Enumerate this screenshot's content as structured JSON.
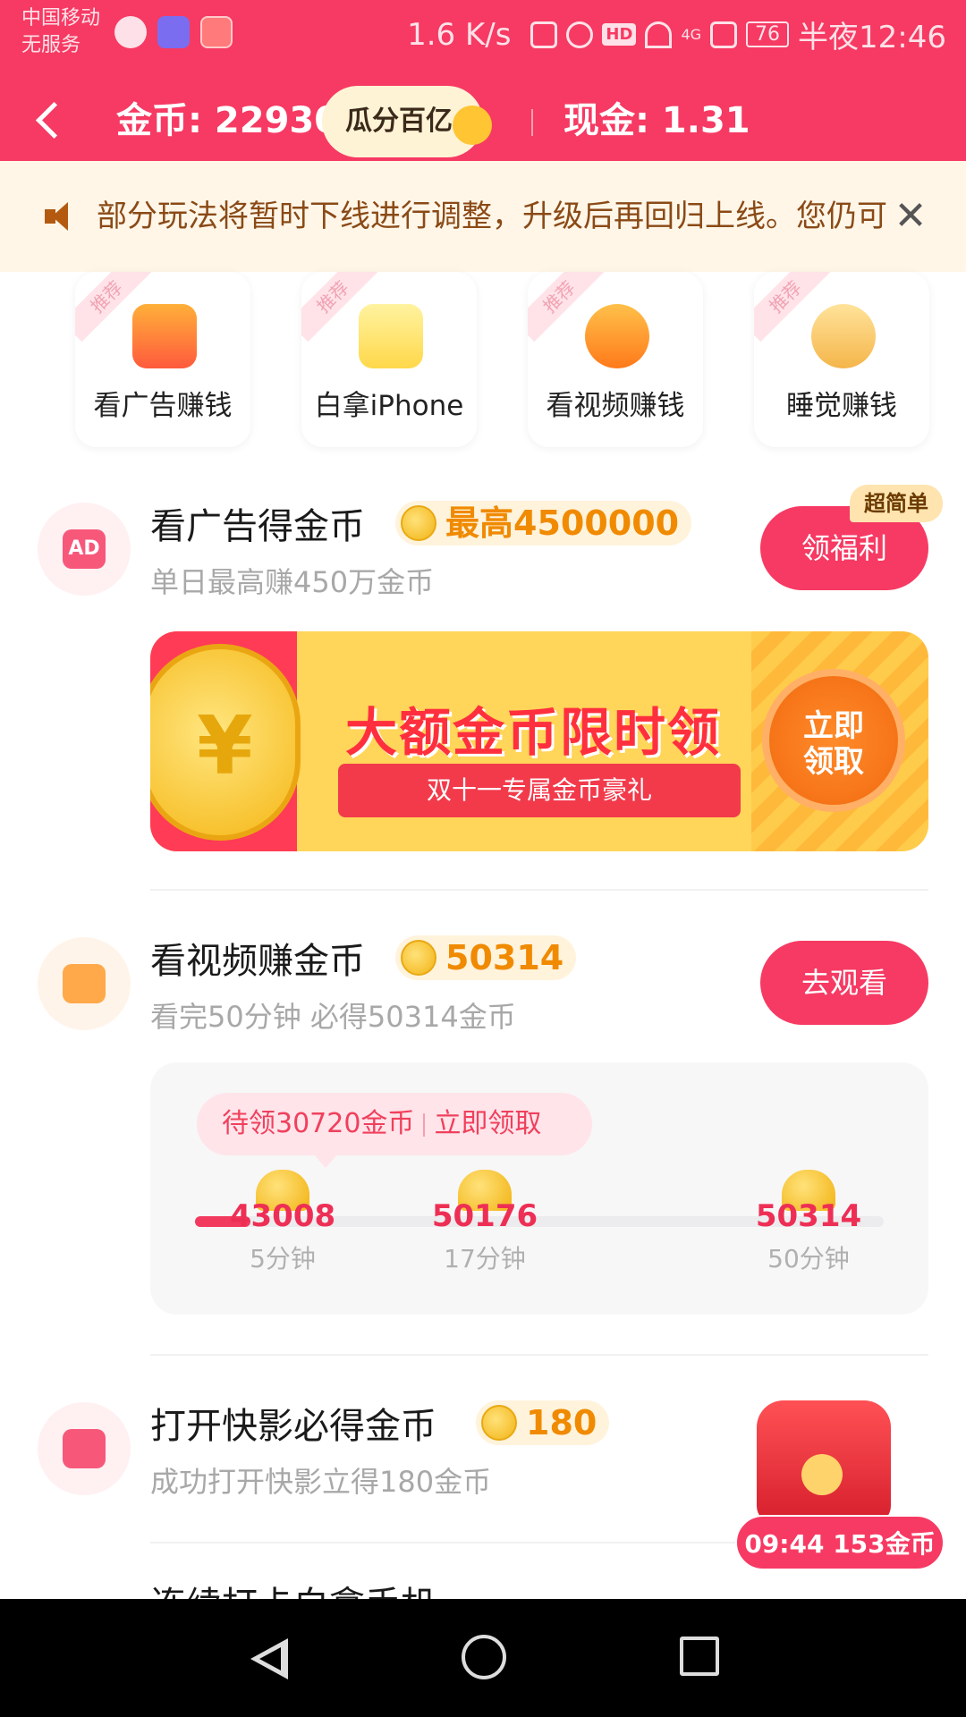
{
  "status_bar": {
    "carrier_line1": "中国移动",
    "carrier_line2": "无服务",
    "speed": "1.6 K/s",
    "hd": "HD",
    "network": "4G",
    "battery": "76",
    "time": "半夜12:46"
  },
  "header": {
    "coins": "金币: 22930",
    "split_pill": "瓜分百亿",
    "cash": "现金: 1.31",
    "bg_color": "#f63a63"
  },
  "notice": {
    "text": "部分玩法将暂时下线进行调整，升级后再回归上线。您仍可",
    "close": "✕"
  },
  "tiles": [
    {
      "tag": "推荐",
      "label": "看广告赚钱",
      "icon": "tv-ad-icon"
    },
    {
      "tag": "推荐",
      "label": "白拿iPhone",
      "icon": "iphone-icon"
    },
    {
      "tag": "推荐",
      "label": "看视频赚钱",
      "icon": "video-camera-icon"
    },
    {
      "tag": "推荐",
      "label": "睡觉赚钱",
      "icon": "sleeping-person-icon"
    }
  ],
  "tasks": {
    "ad": {
      "title": "看广告得金币",
      "reward": "最高4500000",
      "subtitle": "单日最高赚450万金币",
      "button": "领福利",
      "badge": "超简单",
      "icon_text": "AD"
    },
    "banner": {
      "coin_symbol": "¥",
      "headline": "大额金币限时领",
      "ribbon": "双十一专属金币豪礼",
      "claim_line1": "立即",
      "claim_line2": "领取"
    },
    "video": {
      "title": "看视频赚金币",
      "reward": "50314",
      "subtitle": "看完50分钟 必得50314金币",
      "button": "去观看"
    },
    "progress": {
      "pending": "待领30720金币",
      "claim": "立即领取",
      "fill_fraction": 0.08,
      "milestones": [
        {
          "value": "43008",
          "time": "5分钟"
        },
        {
          "value": "50176",
          "time": "17分钟"
        },
        {
          "value": "50314",
          "time": "50分钟"
        }
      ]
    },
    "kuaiying": {
      "title": "打开快影必得金币",
      "reward": "180",
      "subtitle": "成功打开快影立得180金币"
    },
    "next": {
      "title": "连续打卡白拿手机"
    }
  },
  "floating": {
    "timer": "09:44 153金币"
  }
}
